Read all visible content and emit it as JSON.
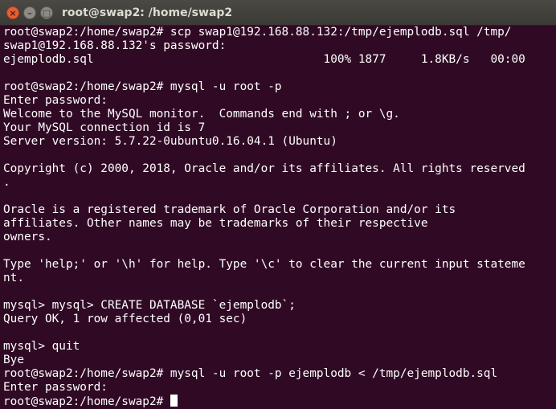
{
  "window": {
    "title": "root@swap2: /home/swap2",
    "close_glyph": "×",
    "minimize_glyph": "–",
    "maximize_glyph": "□"
  },
  "terminal": {
    "lines": [
      "root@swap2:/home/swap2# scp swap1@192.168.88.132:/tmp/ejemplodb.sql /tmp/",
      "swap1@192.168.88.132's password:",
      "ejemplodb.sql                                 100% 1877     1.8KB/s   00:00",
      "",
      "root@swap2:/home/swap2# mysql -u root -p",
      "Enter password:",
      "Welcome to the MySQL monitor.  Commands end with ; or \\g.",
      "Your MySQL connection id is 7",
      "Server version: 5.7.22-0ubuntu0.16.04.1 (Ubuntu)",
      "",
      "Copyright (c) 2000, 2018, Oracle and/or its affiliates. All rights reserved",
      ".",
      "",
      "Oracle is a registered trademark of Oracle Corporation and/or its",
      "affiliates. Other names may be trademarks of their respective",
      "owners.",
      "",
      "Type 'help;' or '\\h' for help. Type '\\c' to clear the current input stateme",
      "nt.",
      "",
      "mysql> mysql> CREATE DATABASE `ejemplodb`;",
      "Query OK, 1 row affected (0,01 sec)",
      "",
      "mysql> quit",
      "Bye",
      "root@swap2:/home/swap2# mysql -u root -p ejemplodb < /tmp/ejemplodb.sql",
      "Enter password:"
    ],
    "prompt": "root@swap2:/home/swap2#"
  },
  "colors": {
    "background": "#300a24",
    "text": "#ffffff",
    "titlebar": "#3c3b37",
    "close_button": "#e65f35"
  }
}
